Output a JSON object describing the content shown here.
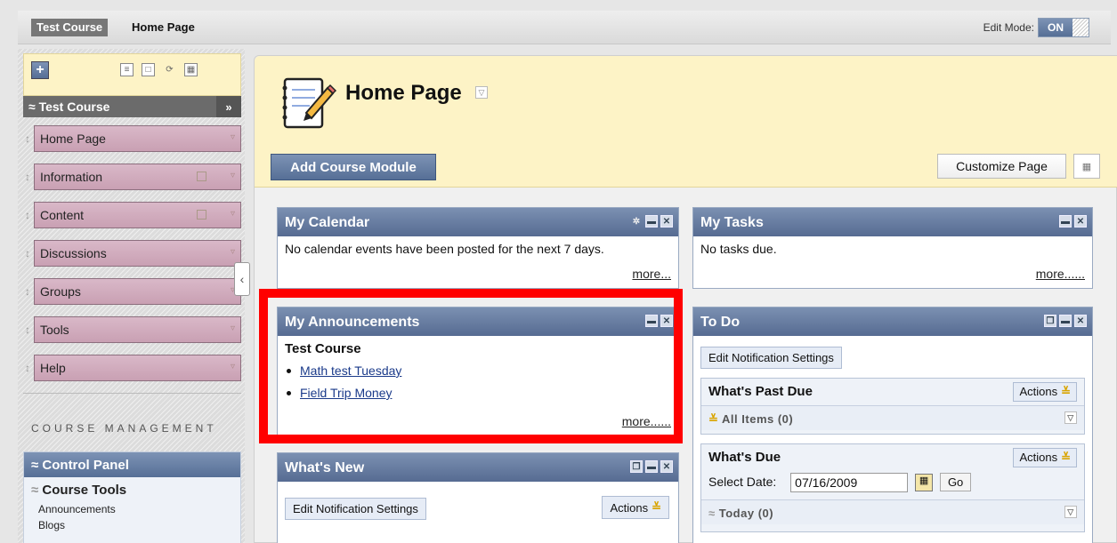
{
  "topbar": {
    "course": "Test Course",
    "page": "Home Page",
    "edit_mode_label": "Edit Mode:",
    "edit_mode_value": "ON"
  },
  "leftnav": {
    "course_title": "Test Course",
    "collapse_symbol": "»",
    "items": [
      {
        "label": "Home Page"
      },
      {
        "label": "Information"
      },
      {
        "label": "Content"
      },
      {
        "label": "Discussions"
      },
      {
        "label": "Groups"
      },
      {
        "label": "Tools"
      },
      {
        "label": "Help"
      }
    ],
    "course_management_label": "COURSE MANAGEMENT",
    "control_panel": {
      "title": "Control Panel",
      "section": "Course Tools",
      "links": [
        "Announcements",
        "Blogs"
      ]
    }
  },
  "main": {
    "title": "Home Page",
    "add_module_label": "Add Course Module",
    "customize_label": "Customize Page"
  },
  "modules": {
    "calendar": {
      "title": "My Calendar",
      "body": "No calendar events have been posted for the next 7 days.",
      "more": "more..."
    },
    "tasks": {
      "title": "My Tasks",
      "body": "No tasks due.",
      "more": "more......"
    },
    "announcements": {
      "title": "My Announcements",
      "course": "Test Course",
      "items": [
        "Math test Tuesday",
        "Field Trip Money"
      ],
      "more": "more......"
    },
    "whatsnew": {
      "title": "What's New",
      "edit_notifications": "Edit Notification Settings",
      "actions": "Actions"
    },
    "todo": {
      "title": "To Do",
      "edit_notifications": "Edit Notification Settings",
      "past_due": {
        "title": "What's Past Due",
        "actions": "Actions",
        "row": "All Items (0)"
      },
      "due": {
        "title": "What's Due",
        "actions": "Actions",
        "select_date_label": "Select Date:",
        "date_value": "07/16/2009",
        "go_label": "Go",
        "row": "Today (0)"
      }
    }
  },
  "colors": {
    "accent_blue": "#566f96",
    "yellow_header": "#fdf3c6",
    "nav_pink": "#d9b8c8",
    "highlight": "#ff0000"
  }
}
